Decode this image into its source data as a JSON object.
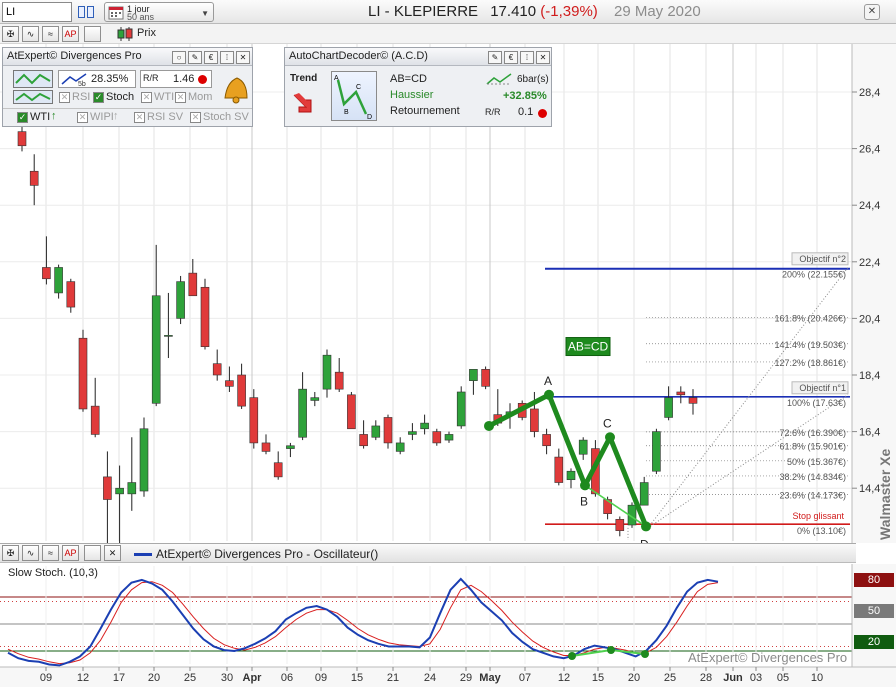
{
  "toolbar": {
    "symbol": "LI",
    "period_line1": "1 jour",
    "period_line2": "50 ans",
    "title_name": "LI - KLEPIERRE",
    "title_price": "17.410",
    "title_change": "(-1,39%)",
    "title_date": "29 May 2020",
    "prix_label": "Prix"
  },
  "divergence_panel": {
    "title": "AtExpert© Divergences Pro",
    "pct": "28.35%",
    "ratio": "1.46",
    "checks": [
      "RSI",
      "Stoch",
      "WTI",
      "Mom"
    ],
    "row3": [
      "WTI",
      "WIPI",
      "RSI SV",
      "Stoch SV"
    ],
    "checked": [
      "Stoch",
      "WTI"
    ]
  },
  "acd_panel": {
    "title": "AutoChartDecoder© (A.C.D)",
    "trend_label": "Trend",
    "pattern_name": "AB=CD",
    "direction": "Haussier",
    "signal": "Retournement",
    "bars": "6bar(s)",
    "pct": "+32.85%",
    "rr": "0.1"
  },
  "chart_data": {
    "type": "candlestick",
    "y_ticks": [
      "28,4",
      "26,4",
      "24,4",
      "22,4",
      "20,4",
      "18,4",
      "16,4",
      "14,4"
    ],
    "x_ticks": [
      "09",
      "12",
      "17",
      "20",
      "25",
      "30",
      "Apr",
      "06",
      "09",
      "15",
      "21",
      "24",
      "29",
      "May",
      "07",
      "12",
      "15",
      "20",
      "25",
      "28",
      "Jun",
      "03",
      "05",
      "10"
    ],
    "candles": [
      {
        "o": 27.0,
        "h": 27.6,
        "l": 26.3,
        "c": 26.5
      },
      {
        "o": 25.6,
        "h": 26.2,
        "l": 24.4,
        "c": 25.1
      },
      {
        "o": 22.2,
        "h": 23.3,
        "l": 21.6,
        "c": 21.8
      },
      {
        "o": 21.3,
        "h": 22.3,
        "l": 21.1,
        "c": 22.2
      },
      {
        "o": 21.7,
        "h": 21.8,
        "l": 20.6,
        "c": 20.8
      },
      {
        "o": 19.7,
        "h": 20.0,
        "l": 17.1,
        "c": 17.2
      },
      {
        "o": 17.3,
        "h": 18.3,
        "l": 16.2,
        "c": 16.3
      },
      {
        "o": 14.8,
        "h": 15.7,
        "l": 12.3,
        "c": 14.0
      },
      {
        "o": 14.2,
        "h": 15.2,
        "l": 12.4,
        "c": 14.4
      },
      {
        "o": 14.2,
        "h": 16.2,
        "l": 13.6,
        "c": 14.6
      },
      {
        "o": 14.3,
        "h": 16.9,
        "l": 14.1,
        "c": 16.5
      },
      {
        "o": 17.4,
        "h": 23.0,
        "l": 17.3,
        "c": 21.2
      },
      {
        "o": 19.8,
        "h": 21.3,
        "l": 19.0,
        "c": 19.8
      },
      {
        "o": 20.4,
        "h": 21.9,
        "l": 20.2,
        "c": 21.7
      },
      {
        "o": 22.0,
        "h": 22.5,
        "l": 21.3,
        "c": 21.2
      },
      {
        "o": 21.5,
        "h": 21.8,
        "l": 19.3,
        "c": 19.4
      },
      {
        "o": 18.8,
        "h": 19.3,
        "l": 18.2,
        "c": 18.4
      },
      {
        "o": 18.2,
        "h": 18.7,
        "l": 17.8,
        "c": 18.0
      },
      {
        "o": 18.4,
        "h": 18.8,
        "l": 17.2,
        "c": 17.3
      },
      {
        "o": 17.6,
        "h": 17.9,
        "l": 15.8,
        "c": 16.0
      },
      {
        "o": 16.0,
        "h": 16.3,
        "l": 15.6,
        "c": 15.7
      },
      {
        "o": 15.3,
        "h": 15.7,
        "l": 14.7,
        "c": 14.8
      },
      {
        "o": 15.8,
        "h": 16.0,
        "l": 15.5,
        "c": 15.9
      },
      {
        "o": 16.2,
        "h": 18.5,
        "l": 16.1,
        "c": 17.9
      },
      {
        "o": 17.5,
        "h": 17.8,
        "l": 17.3,
        "c": 17.6
      },
      {
        "o": 17.9,
        "h": 19.3,
        "l": 17.6,
        "c": 19.1
      },
      {
        "o": 18.5,
        "h": 19.0,
        "l": 17.8,
        "c": 17.9
      },
      {
        "o": 17.7,
        "h": 17.8,
        "l": 16.5,
        "c": 16.5
      },
      {
        "o": 16.3,
        "h": 16.8,
        "l": 15.8,
        "c": 15.9
      },
      {
        "o": 16.2,
        "h": 16.8,
        "l": 16.1,
        "c": 16.6
      },
      {
        "o": 16.9,
        "h": 17.0,
        "l": 15.8,
        "c": 16.0
      },
      {
        "o": 15.7,
        "h": 16.2,
        "l": 15.6,
        "c": 16.0
      },
      {
        "o": 16.3,
        "h": 16.7,
        "l": 16.1,
        "c": 16.4
      },
      {
        "o": 16.5,
        "h": 17.0,
        "l": 16.3,
        "c": 16.7
      },
      {
        "o": 16.4,
        "h": 16.5,
        "l": 15.9,
        "c": 16.0
      },
      {
        "o": 16.1,
        "h": 16.4,
        "l": 16.0,
        "c": 16.3
      },
      {
        "o": 16.6,
        "h": 18.0,
        "l": 16.5,
        "c": 17.8
      },
      {
        "o": 18.2,
        "h": 18.5,
        "l": 17.7,
        "c": 18.6
      },
      {
        "o": 18.6,
        "h": 18.7,
        "l": 17.9,
        "c": 18.0
      },
      {
        "o": 17.0,
        "h": 17.9,
        "l": 16.6,
        "c": 16.7
      },
      {
        "o": 17.0,
        "h": 17.4,
        "l": 16.5,
        "c": 17.1
      },
      {
        "o": 17.4,
        "h": 17.5,
        "l": 16.8,
        "c": 16.9
      },
      {
        "o": 17.2,
        "h": 17.8,
        "l": 16.2,
        "c": 16.4
      },
      {
        "o": 16.3,
        "h": 16.5,
        "l": 15.6,
        "c": 15.9
      },
      {
        "o": 15.5,
        "h": 15.8,
        "l": 14.5,
        "c": 14.6
      },
      {
        "o": 14.7,
        "h": 15.1,
        "l": 14.4,
        "c": 15.0
      },
      {
        "o": 15.6,
        "h": 16.2,
        "l": 15.4,
        "c": 16.1
      },
      {
        "o": 15.8,
        "h": 16.1,
        "l": 14.1,
        "c": 14.2
      },
      {
        "o": 14.0,
        "h": 14.1,
        "l": 13.3,
        "c": 13.5
      },
      {
        "o": 13.3,
        "h": 13.4,
        "l": 12.7,
        "c": 12.9
      },
      {
        "o": 13.1,
        "h": 13.9,
        "l": 13.0,
        "c": 13.8
      },
      {
        "o": 13.8,
        "h": 14.8,
        "l": 13.8,
        "c": 14.6
      },
      {
        "o": 15.0,
        "h": 16.5,
        "l": 14.9,
        "c": 16.4
      },
      {
        "o": 16.9,
        "h": 18.0,
        "l": 16.8,
        "c": 17.6
      },
      {
        "o": 17.8,
        "h": 18.0,
        "l": 17.4,
        "c": 17.7
      },
      {
        "o": 17.6,
        "h": 17.9,
        "l": 17.0,
        "c": 17.4
      }
    ],
    "pattern": {
      "label": "AB=CD",
      "point_labels": [
        "A",
        "B",
        "C",
        "D"
      ]
    },
    "levels": [
      {
        "label": "Objectif n°2",
        "value": 22.4
      },
      {
        "label": "200% (22.155€)",
        "value": 22.155
      },
      {
        "label": "161.8% (20.426€)",
        "value": 20.426
      },
      {
        "label": "141.4% (19.503€)",
        "value": 19.503
      },
      {
        "label": "127.2% (18.861€)",
        "value": 18.861
      },
      {
        "label": "Objectif n°1",
        "value": 17.63
      },
      {
        "label": "100% (17.63€)",
        "value": 17.63
      },
      {
        "label": "72.6% (16.390€)",
        "value": 16.39
      },
      {
        "label": "61.8% (15.901€)",
        "value": 15.901
      },
      {
        "label": "50% (15.367€)",
        "value": 15.367
      },
      {
        "label": "38.2% (14.834€)",
        "value": 14.834
      },
      {
        "label": "23.6% (14.173€)",
        "value": 14.173
      },
      {
        "label": "Stop glissant",
        "value": 13.13
      },
      {
        "label": "0% (13.10€)",
        "value": 13.1
      }
    ]
  },
  "oscillator": {
    "header": "AtExpert© Divergences Pro - Oscillateur()",
    "stoch_label": "Slow Stoch. (10,3)",
    "levels": [
      "80",
      "50",
      "20"
    ],
    "watermark": "AtExpert© Divergences Pro",
    "stoch_k": [
      18,
      12,
      9,
      8,
      5,
      4,
      8,
      14,
      25,
      45,
      66,
      85,
      96,
      99,
      95,
      88,
      75,
      60,
      45,
      33,
      25,
      21,
      20,
      23,
      28,
      34,
      42,
      55,
      62,
      68,
      70,
      66,
      58,
      46,
      38,
      32,
      28,
      25,
      25,
      25,
      24,
      35,
      62,
      88,
      100,
      88,
      74,
      64,
      54,
      40,
      30,
      22,
      18,
      14,
      12,
      15,
      22,
      26,
      24,
      22,
      18,
      14,
      20,
      32,
      48,
      68,
      86,
      96,
      99,
      97
    ],
    "stoch_d": [
      22,
      17,
      13,
      11,
      8,
      6,
      7,
      10,
      18,
      32,
      52,
      74,
      88,
      96,
      97,
      93,
      85,
      72,
      58,
      45,
      34,
      27,
      23,
      21,
      24,
      29,
      36,
      46,
      55,
      62,
      66,
      66,
      62,
      54,
      45,
      38,
      33,
      29,
      27,
      26,
      25,
      28,
      44,
      68,
      88,
      93,
      86,
      76,
      65,
      52,
      41,
      31,
      24,
      19,
      15,
      15,
      18,
      22,
      24,
      23,
      21,
      18,
      18,
      24,
      36,
      52,
      70,
      86,
      94,
      96
    ]
  },
  "sidebar": {
    "vertical_brand": "Walmaster Xe"
  },
  "colors": {
    "up_candle": "#2ea23a",
    "down_candle": "#e03a3a",
    "pattern": "#1e8a1e",
    "level_blue": "#1a2fb5",
    "stop_red": "#d11a1a",
    "stoch_k": "#1b3fb3",
    "stoch_d": "#d92020"
  }
}
